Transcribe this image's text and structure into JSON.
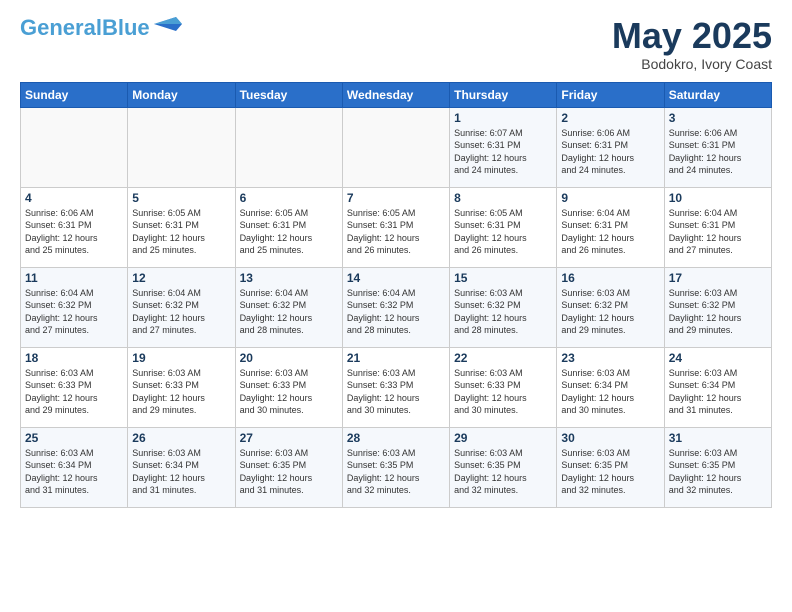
{
  "header": {
    "logo_line1": "General",
    "logo_line2": "Blue",
    "month": "May 2025",
    "location": "Bodokro, Ivory Coast"
  },
  "weekdays": [
    "Sunday",
    "Monday",
    "Tuesday",
    "Wednesday",
    "Thursday",
    "Friday",
    "Saturday"
  ],
  "weeks": [
    [
      {
        "day": "",
        "info": ""
      },
      {
        "day": "",
        "info": ""
      },
      {
        "day": "",
        "info": ""
      },
      {
        "day": "",
        "info": ""
      },
      {
        "day": "1",
        "info": "Sunrise: 6:07 AM\nSunset: 6:31 PM\nDaylight: 12 hours\nand 24 minutes."
      },
      {
        "day": "2",
        "info": "Sunrise: 6:06 AM\nSunset: 6:31 PM\nDaylight: 12 hours\nand 24 minutes."
      },
      {
        "day": "3",
        "info": "Sunrise: 6:06 AM\nSunset: 6:31 PM\nDaylight: 12 hours\nand 24 minutes."
      }
    ],
    [
      {
        "day": "4",
        "info": "Sunrise: 6:06 AM\nSunset: 6:31 PM\nDaylight: 12 hours\nand 25 minutes."
      },
      {
        "day": "5",
        "info": "Sunrise: 6:05 AM\nSunset: 6:31 PM\nDaylight: 12 hours\nand 25 minutes."
      },
      {
        "day": "6",
        "info": "Sunrise: 6:05 AM\nSunset: 6:31 PM\nDaylight: 12 hours\nand 25 minutes."
      },
      {
        "day": "7",
        "info": "Sunrise: 6:05 AM\nSunset: 6:31 PM\nDaylight: 12 hours\nand 26 minutes."
      },
      {
        "day": "8",
        "info": "Sunrise: 6:05 AM\nSunset: 6:31 PM\nDaylight: 12 hours\nand 26 minutes."
      },
      {
        "day": "9",
        "info": "Sunrise: 6:04 AM\nSunset: 6:31 PM\nDaylight: 12 hours\nand 26 minutes."
      },
      {
        "day": "10",
        "info": "Sunrise: 6:04 AM\nSunset: 6:31 PM\nDaylight: 12 hours\nand 27 minutes."
      }
    ],
    [
      {
        "day": "11",
        "info": "Sunrise: 6:04 AM\nSunset: 6:32 PM\nDaylight: 12 hours\nand 27 minutes."
      },
      {
        "day": "12",
        "info": "Sunrise: 6:04 AM\nSunset: 6:32 PM\nDaylight: 12 hours\nand 27 minutes."
      },
      {
        "day": "13",
        "info": "Sunrise: 6:04 AM\nSunset: 6:32 PM\nDaylight: 12 hours\nand 28 minutes."
      },
      {
        "day": "14",
        "info": "Sunrise: 6:04 AM\nSunset: 6:32 PM\nDaylight: 12 hours\nand 28 minutes."
      },
      {
        "day": "15",
        "info": "Sunrise: 6:03 AM\nSunset: 6:32 PM\nDaylight: 12 hours\nand 28 minutes."
      },
      {
        "day": "16",
        "info": "Sunrise: 6:03 AM\nSunset: 6:32 PM\nDaylight: 12 hours\nand 29 minutes."
      },
      {
        "day": "17",
        "info": "Sunrise: 6:03 AM\nSunset: 6:32 PM\nDaylight: 12 hours\nand 29 minutes."
      }
    ],
    [
      {
        "day": "18",
        "info": "Sunrise: 6:03 AM\nSunset: 6:33 PM\nDaylight: 12 hours\nand 29 minutes."
      },
      {
        "day": "19",
        "info": "Sunrise: 6:03 AM\nSunset: 6:33 PM\nDaylight: 12 hours\nand 29 minutes."
      },
      {
        "day": "20",
        "info": "Sunrise: 6:03 AM\nSunset: 6:33 PM\nDaylight: 12 hours\nand 30 minutes."
      },
      {
        "day": "21",
        "info": "Sunrise: 6:03 AM\nSunset: 6:33 PM\nDaylight: 12 hours\nand 30 minutes."
      },
      {
        "day": "22",
        "info": "Sunrise: 6:03 AM\nSunset: 6:33 PM\nDaylight: 12 hours\nand 30 minutes."
      },
      {
        "day": "23",
        "info": "Sunrise: 6:03 AM\nSunset: 6:34 PM\nDaylight: 12 hours\nand 30 minutes."
      },
      {
        "day": "24",
        "info": "Sunrise: 6:03 AM\nSunset: 6:34 PM\nDaylight: 12 hours\nand 31 minutes."
      }
    ],
    [
      {
        "day": "25",
        "info": "Sunrise: 6:03 AM\nSunset: 6:34 PM\nDaylight: 12 hours\nand 31 minutes."
      },
      {
        "day": "26",
        "info": "Sunrise: 6:03 AM\nSunset: 6:34 PM\nDaylight: 12 hours\nand 31 minutes."
      },
      {
        "day": "27",
        "info": "Sunrise: 6:03 AM\nSunset: 6:35 PM\nDaylight: 12 hours\nand 31 minutes."
      },
      {
        "day": "28",
        "info": "Sunrise: 6:03 AM\nSunset: 6:35 PM\nDaylight: 12 hours\nand 32 minutes."
      },
      {
        "day": "29",
        "info": "Sunrise: 6:03 AM\nSunset: 6:35 PM\nDaylight: 12 hours\nand 32 minutes."
      },
      {
        "day": "30",
        "info": "Sunrise: 6:03 AM\nSunset: 6:35 PM\nDaylight: 12 hours\nand 32 minutes."
      },
      {
        "day": "31",
        "info": "Sunrise: 6:03 AM\nSunset: 6:35 PM\nDaylight: 12 hours\nand 32 minutes."
      }
    ]
  ]
}
